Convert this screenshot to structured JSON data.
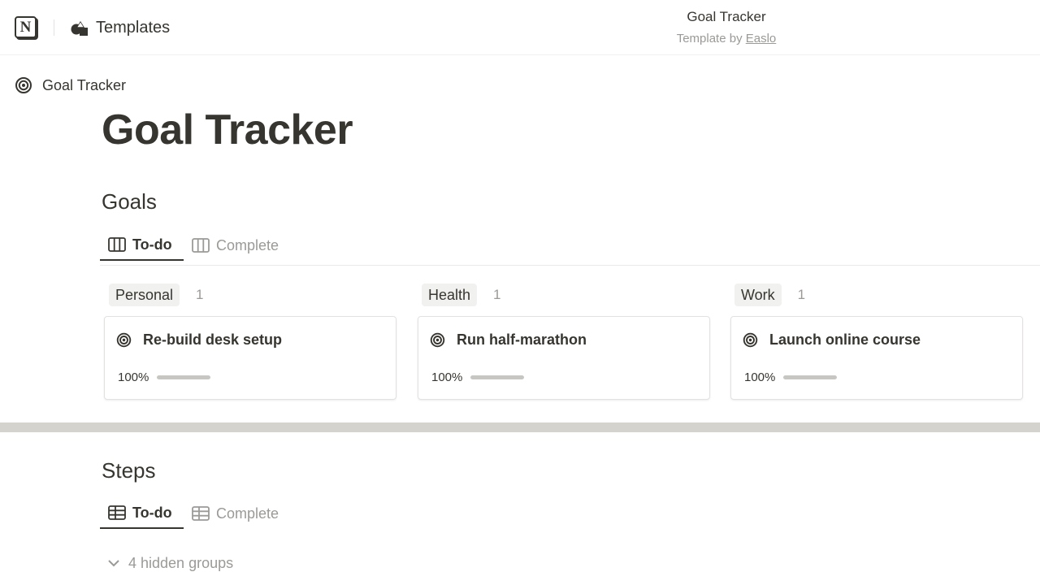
{
  "topbar": {
    "templates_label": "Templates",
    "page_name": "Goal Tracker",
    "template_by": "Template by",
    "author": "Easlo"
  },
  "breadcrumb": {
    "label": "Goal Tracker"
  },
  "page": {
    "title": "Goal Tracker"
  },
  "goals": {
    "title": "Goals",
    "tabs": [
      {
        "label": "To-do",
        "active": true
      },
      {
        "label": "Complete",
        "active": false
      }
    ],
    "groups": [
      {
        "name": "Personal",
        "count": "1",
        "card": {
          "title": "Re-build desk setup",
          "progress_label": "100%",
          "progress": 1.0
        }
      },
      {
        "name": "Health",
        "count": "1",
        "card": {
          "title": "Run half-marathon",
          "progress_label": "100%",
          "progress": 1.0
        }
      },
      {
        "name": "Work",
        "count": "1",
        "card": {
          "title": "Launch online course",
          "progress_label": "100%",
          "progress": 1.0
        }
      }
    ]
  },
  "steps": {
    "title": "Steps",
    "tabs": [
      {
        "label": "To-do",
        "active": true
      },
      {
        "label": "Complete",
        "active": false
      }
    ],
    "hidden_groups": "4 hidden groups"
  },
  "icons": {
    "logo": "notion-logo-icon",
    "templates": "shapes-icon",
    "goal": "target-icon",
    "board": "board-view-icon",
    "table": "table-view-icon",
    "chevron": "chevron-down-icon"
  },
  "colors": {
    "text": "#37352f",
    "muted": "#9b9a97",
    "tag_bg": "#f1f1ef",
    "divider": "#d5d3cd",
    "bar_fill": "#c7c6c3"
  }
}
